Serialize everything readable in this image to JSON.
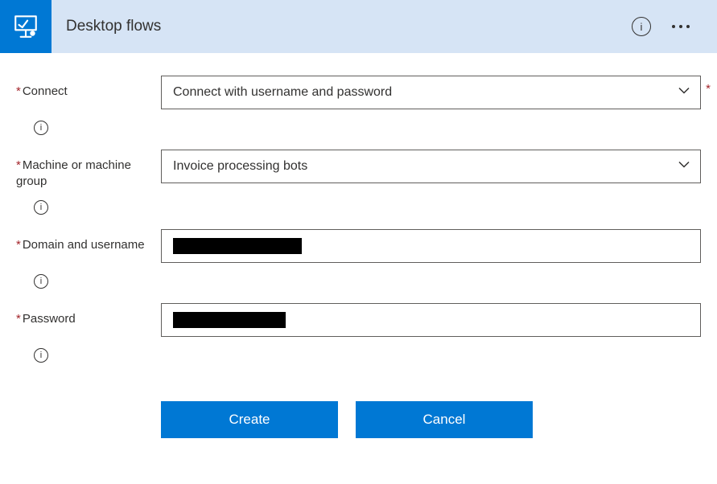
{
  "header": {
    "title": "Desktop flows"
  },
  "fields": {
    "connect": {
      "label": "Connect",
      "value": "Connect with username and password"
    },
    "machine": {
      "label": "Machine or machine group",
      "value": "Invoice processing bots"
    },
    "domain": {
      "label": "Domain and username"
    },
    "password": {
      "label": "Password"
    }
  },
  "buttons": {
    "create": "Create",
    "cancel": "Cancel"
  }
}
